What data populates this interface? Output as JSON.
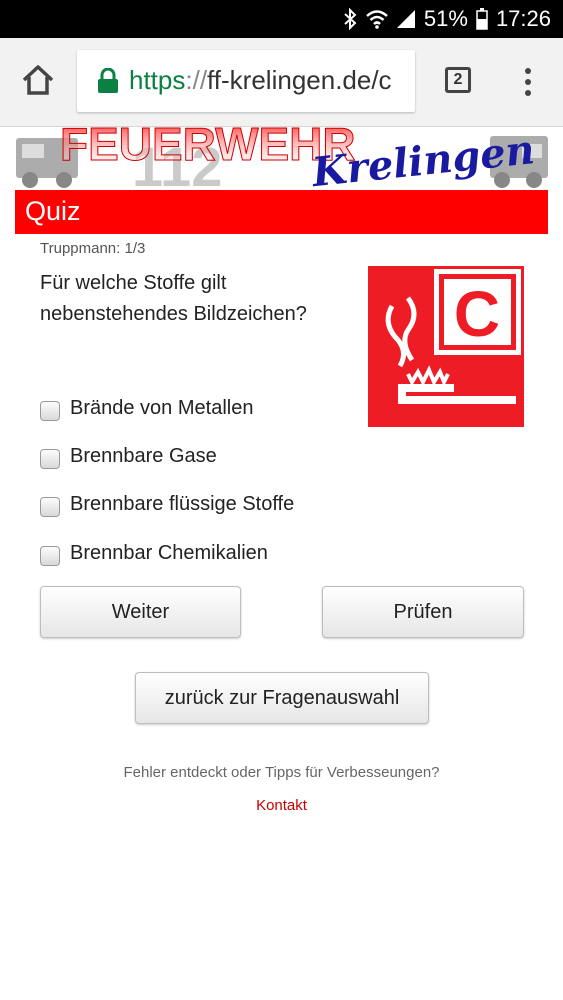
{
  "status_bar": {
    "battery_percent": "51%",
    "time": "17:26",
    "icons": [
      "bluetooth-icon",
      "wifi-icon",
      "signal-icon",
      "battery-icon"
    ]
  },
  "browser": {
    "url_scheme": "https",
    "url_separator": "://",
    "url_host": "ff-krelingen.de/c",
    "tab_count": "2",
    "icons": [
      "home-icon",
      "lock-icon",
      "tabs-icon",
      "menu-icon"
    ]
  },
  "banner": {
    "title": "FEUERWEHR",
    "number": "112",
    "subtitle": "Krelingen"
  },
  "page": {
    "section_title": "Quiz",
    "progress": "Truppmann: 1/3",
    "question": "Für welche Stoffe gilt nebenstehendes Bildzeichen?",
    "sign_letter": "C",
    "answers": [
      "Brände von Metallen",
      "Brennbare Gase",
      "Brennbare flüssige Stoffe",
      "Brennbar Chemikalien"
    ],
    "buttons": {
      "next": "Weiter",
      "check": "Prüfen",
      "back": "zurück zur Fragenauswahl"
    },
    "footer_note": "Fehler entdeckt oder Tipps für Verbesseungen?",
    "contact_link": "Kontakt"
  },
  "colors": {
    "accent_red": "#ff0000",
    "link_red": "#cc0000",
    "secure_green": "#0b8043"
  }
}
